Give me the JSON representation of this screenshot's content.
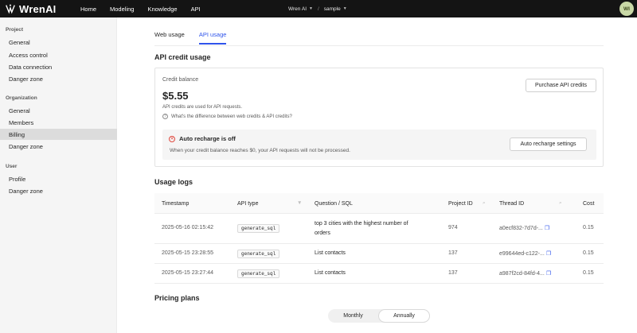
{
  "topbar": {
    "brand": "WrenAI",
    "nav": [
      "Home",
      "Modeling",
      "Knowledge",
      "API"
    ],
    "workspace": "Wren AI",
    "project": "sample",
    "avatar_initials": "WI"
  },
  "sidebar": {
    "groups": [
      {
        "title": "Project",
        "items": [
          "General",
          "Access control",
          "Data connection",
          "Danger zone"
        ]
      },
      {
        "title": "Organization",
        "items": [
          "General",
          "Members",
          "Billing",
          "Danger zone"
        ]
      },
      {
        "title": "User",
        "items": [
          "Profile",
          "Danger zone"
        ]
      }
    ],
    "active_item": "Billing"
  },
  "tabs": [
    "Web usage",
    "API usage"
  ],
  "active_tab": "API usage",
  "credit": {
    "section_title": "API credit usage",
    "balance_label": "Credit balance",
    "balance": "$5.55",
    "note": "API credits are used for API requests.",
    "help": "What's the difference between web credits & API credits?",
    "purchase_button": "Purchase API credits",
    "recharge_title": "Auto recharge is off",
    "recharge_desc": "When your credit balance reaches $0, your API requests will not be processed.",
    "recharge_button": "Auto recharge settings"
  },
  "usage": {
    "title": "Usage logs",
    "columns": [
      "Timestamp",
      "API type",
      "Question / SQL",
      "Project ID",
      "Thread ID",
      "Cost"
    ],
    "rows": [
      {
        "timestamp": "2025-05-16 02:15:42",
        "api_type": "generate_sql",
        "question_1": "top 3 cities with the highest number of",
        "question_2": "orders",
        "project_id": "974",
        "thread_id": "a0ecf832-7d7d-...",
        "cost": "0.15"
      },
      {
        "timestamp": "2025-05-15 23:28:55",
        "api_type": "generate_sql",
        "question_1": "List contacts",
        "question_2": "",
        "project_id": "137",
        "thread_id": "e99644ed-c122-...",
        "cost": "0.15"
      },
      {
        "timestamp": "2025-05-15 23:27:44",
        "api_type": "generate_sql",
        "question_1": "List contacts",
        "question_2": "",
        "project_id": "137",
        "thread_id": "a987f2cd-84fd-4...",
        "cost": "0.15"
      }
    ]
  },
  "pricing": {
    "title": "Pricing plans",
    "options": [
      "Monthly",
      "Annually"
    ],
    "active": "Annually"
  }
}
